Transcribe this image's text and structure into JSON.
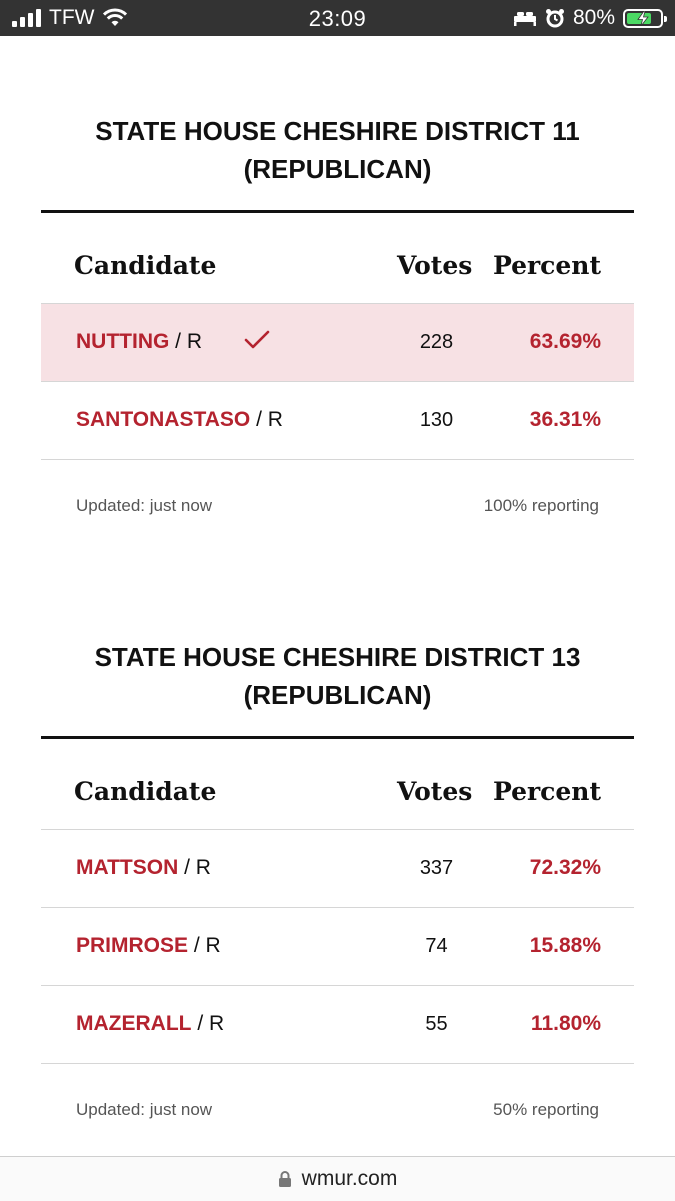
{
  "status_bar": {
    "carrier": "TFW",
    "time": "23:09",
    "battery": "80%"
  },
  "races": [
    {
      "title_line1": "STATE HOUSE CHESHIRE DISTRICT 11",
      "title_line2": "(REPUBLICAN)",
      "headers": {
        "candidate": "Candidate",
        "votes": "Votes",
        "percent": "Percent"
      },
      "rows": [
        {
          "name": "NUTTING",
          "party": " / R",
          "votes": "228",
          "percent": "63.69%",
          "winner": true
        },
        {
          "name": "SANTONASTASO",
          "party": " / R",
          "votes": "130",
          "percent": "36.31%",
          "winner": false
        }
      ],
      "updated": "Updated: just now",
      "reporting": "100% reporting"
    },
    {
      "title_line1": "STATE HOUSE CHESHIRE DISTRICT 13",
      "title_line2": "(REPUBLICAN)",
      "headers": {
        "candidate": "Candidate",
        "votes": "Votes",
        "percent": "Percent"
      },
      "rows": [
        {
          "name": "MATTSON",
          "party": " / R",
          "votes": "337",
          "percent": "72.32%",
          "winner": false
        },
        {
          "name": "PRIMROSE",
          "party": " / R",
          "votes": "74",
          "percent": "15.88%",
          "winner": false
        },
        {
          "name": "MAZERALL",
          "party": " / R",
          "votes": "55",
          "percent": "11.80%",
          "winner": false
        }
      ],
      "updated": "Updated: just now",
      "reporting": "50% reporting"
    }
  ],
  "url_bar": {
    "domain": "wmur.com"
  },
  "colors": {
    "accent": "#b4232f",
    "winner_bg": "#f7e1e4",
    "battery_green": "#4cd964"
  }
}
